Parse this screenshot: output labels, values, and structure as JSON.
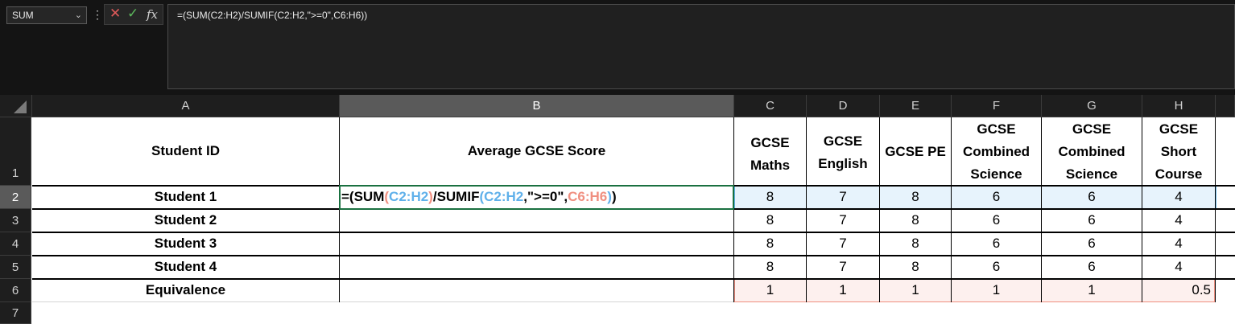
{
  "namebox": {
    "value": "SUM"
  },
  "formula_bar": {
    "value": "=(SUM(C2:H2)/SUMIF(C2:H2,\">=0\",C6:H6))"
  },
  "columns": [
    "A",
    "B",
    "C",
    "D",
    "E",
    "F",
    "G",
    "H"
  ],
  "rows": [
    "1",
    "2",
    "3",
    "4",
    "5",
    "6",
    "7"
  ],
  "headers": {
    "A": "Student ID",
    "B": "Average GCSE Score",
    "C": [
      "GCSE",
      "Maths"
    ],
    "D": [
      "GCSE",
      "English"
    ],
    "E": [
      "GCSE PE"
    ],
    "F": [
      "GCSE",
      "Combined",
      "Science"
    ],
    "G": [
      "GCSE",
      "Combined",
      "Science"
    ],
    "H": [
      "GCSE",
      "Short",
      "Course"
    ]
  },
  "students": [
    {
      "id": "Student 1",
      "scores": [
        "8",
        "7",
        "8",
        "6",
        "6",
        "4"
      ]
    },
    {
      "id": "Student 2",
      "scores": [
        "8",
        "7",
        "8",
        "6",
        "6",
        "4"
      ]
    },
    {
      "id": "Student 3",
      "scores": [
        "8",
        "7",
        "8",
        "6",
        "6",
        "4"
      ]
    },
    {
      "id": "Student 4",
      "scores": [
        "8",
        "7",
        "8",
        "6",
        "6",
        "4"
      ]
    }
  ],
  "equivalence": {
    "label": "Equivalence",
    "values": [
      "1",
      "1",
      "1",
      "1",
      "1",
      "0.5"
    ]
  },
  "edit_formula": {
    "p1": "=(SUM",
    "p2": "(",
    "ref1": "C2:H2",
    "p3": ")",
    "p4": "/SUMIF",
    "p5": "(",
    "ref2": "C2:H2",
    "p6": ",\">=0\",",
    "ref3": "C6:H6",
    "p7": ")",
    "p8": ")"
  },
  "colors": {
    "accent_green": "#1a7040",
    "ref_blue": "#5fb0ea",
    "ref_red": "#f08f80",
    "cancel_red": "#e05a5a",
    "enter_green": "#5cb85c"
  },
  "icons": {
    "cancel": "close-icon",
    "enter": "check-icon",
    "function": "fx-icon",
    "namebox_dropdown": "chevron-down-icon"
  }
}
